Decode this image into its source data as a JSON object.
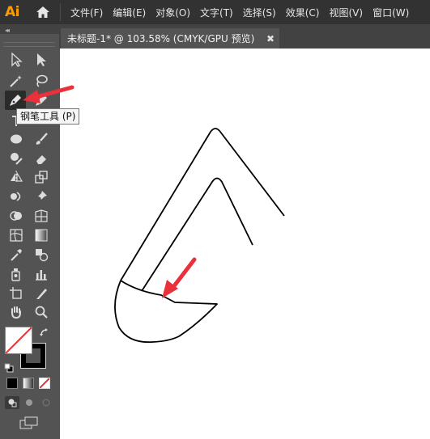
{
  "app": {
    "logo": "Ai",
    "accent_color": "#ff9a00"
  },
  "menubar": {
    "home_icon": "home-icon",
    "items": [
      {
        "label": "文件(F)"
      },
      {
        "label": "编辑(E)"
      },
      {
        "label": "对象(O)"
      },
      {
        "label": "文字(T)"
      },
      {
        "label": "选择(S)"
      },
      {
        "label": "效果(C)"
      },
      {
        "label": "视图(V)"
      },
      {
        "label": "窗口(W)"
      }
    ]
  },
  "document_tab": {
    "title": "未标题-1* @ 103.58% (CMYK/GPU 预览)",
    "close_label": "✖"
  },
  "panel_collapse_label": "◂◂",
  "toolbar": {
    "active_tool": "pen-tool",
    "tooltip": "钢笔工具 (P)",
    "fill_color": "#ffffff",
    "stroke_color": "#000000"
  },
  "annotation": {
    "arrow_color": "#e8313a"
  }
}
